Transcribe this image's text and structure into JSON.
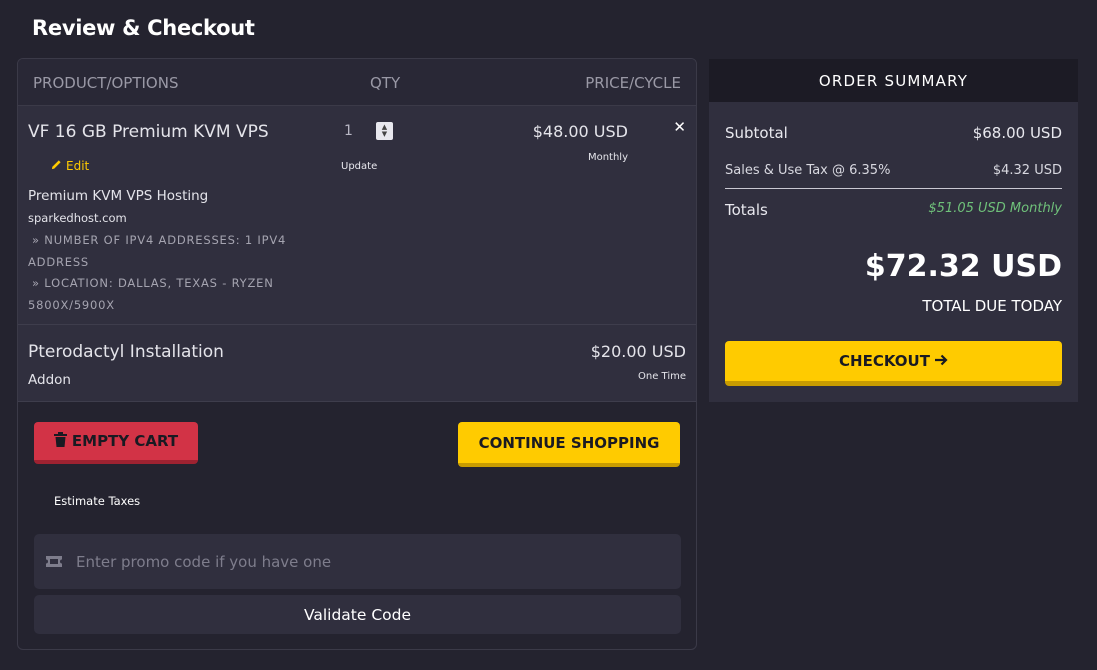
{
  "page": {
    "title": "Review & Checkout"
  },
  "cart": {
    "headers": {
      "product": "Product/Options",
      "qty": "Qty",
      "price": "Price/Cycle"
    },
    "items": [
      {
        "name": "VF 16 GB Premium KVM VPS",
        "edit_label": "Edit",
        "group": "Premium KVM VPS Hosting",
        "domain": "sparkedhost.com",
        "options": [
          "» Number of IPv4 Addresses: 1 IPv4 Address",
          "» Location: Dallas, Texas - Ryzen 5800X/5900X"
        ],
        "qty": "1",
        "update_label": "Update",
        "price": "$48.00 USD",
        "cycle": "Monthly",
        "remove_icon": "close-icon"
      },
      {
        "name": "Pterodactyl Installation",
        "type": "Addon",
        "price": "$20.00 USD",
        "cycle": "One Time"
      }
    ],
    "empty_label": "EMPTY CART",
    "continue_label": "CONTINUE SHOPPING",
    "estimate_label": "Estimate Taxes",
    "promo_placeholder": "Enter promo code if you have one",
    "validate_label": "Validate Code"
  },
  "summary": {
    "heading": "Order Summary",
    "subtotal_label": "Subtotal",
    "subtotal_value": "$68.00 USD",
    "tax_label": "Sales & Use Tax @ 6.35%",
    "tax_value": "$4.32 USD",
    "totals_label": "Totals",
    "recurring": "$51.05 USD Monthly",
    "total_due": "$72.32 USD",
    "total_due_label": "TOTAL DUE TODAY",
    "checkout_label": "CHECKOUT"
  },
  "colors": {
    "accent": "#ffcb00",
    "danger": "#d23346",
    "recurring": "#6fc17a",
    "background": "#24232f"
  }
}
